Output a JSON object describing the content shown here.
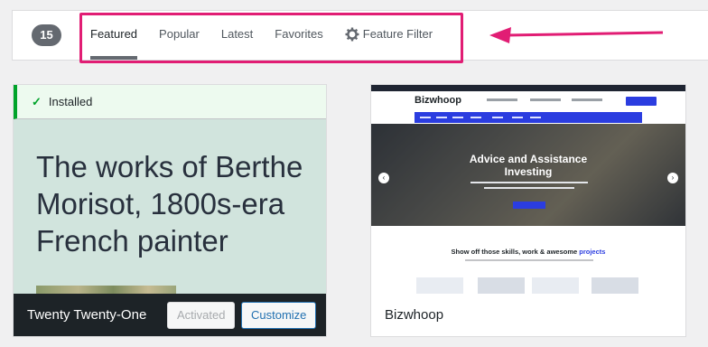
{
  "filter": {
    "count": "15",
    "tabs": [
      {
        "label": "Featured"
      },
      {
        "label": "Popular"
      },
      {
        "label": "Latest"
      },
      {
        "label": "Favorites"
      },
      {
        "label": "Feature Filter",
        "icon": "gear-icon"
      }
    ]
  },
  "annotation": {
    "color": "#e11d74"
  },
  "themes": [
    {
      "name": "Twenty Twenty-One",
      "status": "Installed",
      "headline": "The works of Berthe Morisot, 1800s-era French painter",
      "buttons": {
        "activated": "Activated",
        "customize": "Customize"
      }
    },
    {
      "name": "Bizwhoop",
      "preview": {
        "logo": "Bizwhoop",
        "hero_title_line1": "Advice and Assistance",
        "hero_title_line2": "Investing",
        "section_title": "Show off those skills, work & awesome",
        "section_title_accent": "projects"
      }
    }
  ],
  "colors": {
    "accent": "#2271b1",
    "installed": "#00a32a",
    "dark": "#1d2327",
    "biz_blue": "#2b3de0"
  }
}
